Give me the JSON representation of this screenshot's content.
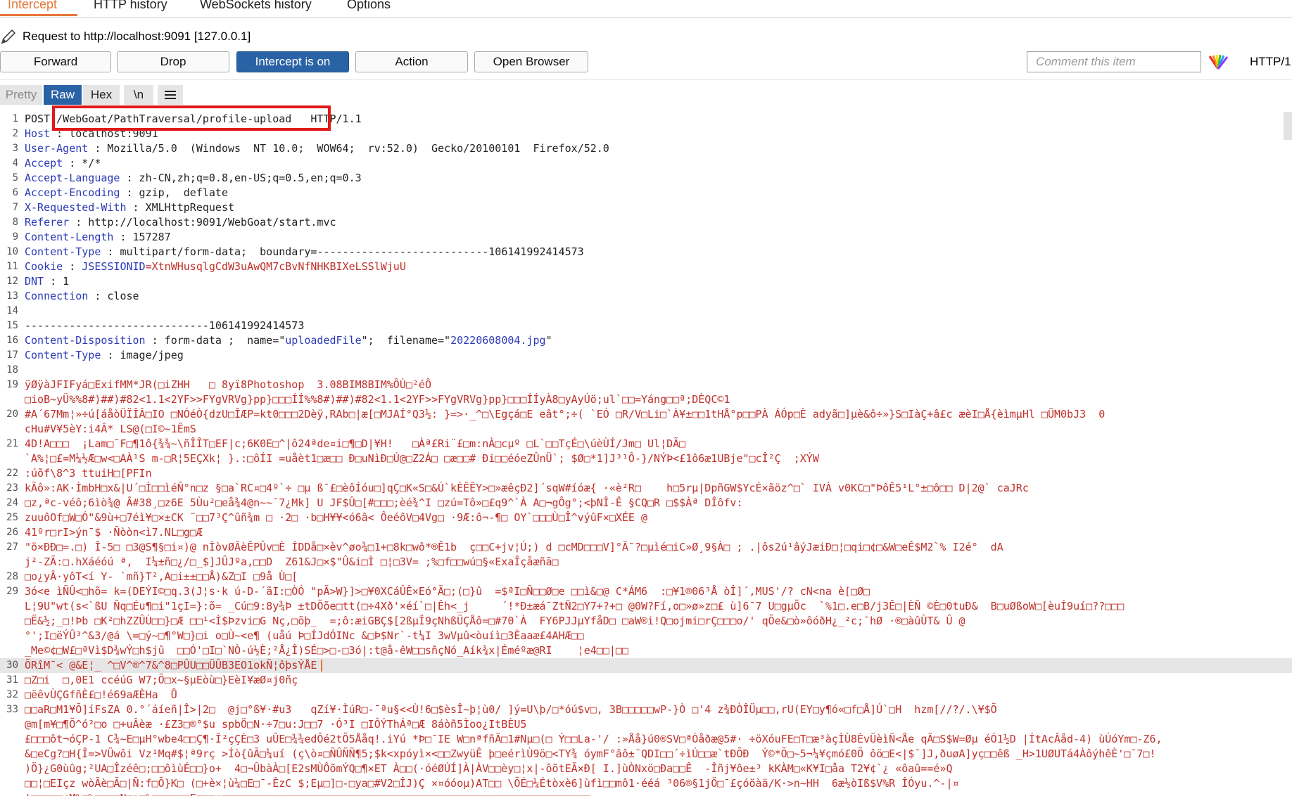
{
  "tabs": [
    "Intercept",
    "HTTP history",
    "WebSockets history",
    "Options"
  ],
  "request_line": "Request to http://localhost:9091  [127.0.0.1]",
  "buttons": {
    "forward": "Forward",
    "drop": "Drop",
    "intercept": "Intercept is on",
    "action": "Action",
    "open_browser": "Open Browser"
  },
  "comment_placeholder": "Comment this item",
  "http_version": "HTTP/1",
  "view_tabs": [
    "Pretty",
    "Raw",
    "Hex",
    "\\n"
  ],
  "menu_icon": "hamburger-menu-icon",
  "colors": {
    "accent": "#e8743a",
    "primary": "#2a63a5",
    "highlight": "#e01919"
  },
  "lines": [
    {
      "n": "1",
      "segs": [
        {
          "t": "POST ",
          "c": "v"
        },
        {
          "t": "/WebGoat/PathTraversal/profile-upload",
          "c": "v"
        },
        {
          "t": "   HTTP/1.1",
          "c": "v"
        }
      ]
    },
    {
      "n": "2",
      "segs": [
        {
          "t": "Host",
          "c": "k"
        },
        {
          "t": " : localhost:9091",
          "c": "v"
        }
      ]
    },
    {
      "n": "3",
      "segs": [
        {
          "t": "User-Agent",
          "c": "k"
        },
        {
          "t": " : Mozilla/5.0  (Windows  NT 10.0;  WOW64;  rv:52.0)  Gecko/20100101  Firefox/52.0",
          "c": "v"
        }
      ]
    },
    {
      "n": "4",
      "segs": [
        {
          "t": "Accept",
          "c": "k"
        },
        {
          "t": " : */*",
          "c": "v"
        }
      ]
    },
    {
      "n": "5",
      "segs": [
        {
          "t": "Accept-Language",
          "c": "k"
        },
        {
          "t": " : zh-CN,zh;q=0.8,en-US;q=0.5,en;q=0.3",
          "c": "v"
        }
      ]
    },
    {
      "n": "6",
      "segs": [
        {
          "t": "Accept-Encoding",
          "c": "k"
        },
        {
          "t": " : gzip,  deflate",
          "c": "v"
        }
      ]
    },
    {
      "n": "7",
      "segs": [
        {
          "t": "X-Requested-With",
          "c": "k"
        },
        {
          "t": " : XMLHttpRequest",
          "c": "v"
        }
      ]
    },
    {
      "n": "8",
      "segs": [
        {
          "t": "Referer",
          "c": "k"
        },
        {
          "t": " : http://localhost:9091/WebGoat/start.mvc",
          "c": "v"
        }
      ]
    },
    {
      "n": "9",
      "segs": [
        {
          "t": "Content-Length",
          "c": "k"
        },
        {
          "t": " : 157287",
          "c": "v"
        }
      ]
    },
    {
      "n": "10",
      "segs": [
        {
          "t": "Content-Type",
          "c": "k"
        },
        {
          "t": " : multipart/form-data;  boundary=---------------------------106141992414573",
          "c": "v"
        }
      ]
    },
    {
      "n": "11",
      "segs": [
        {
          "t": "Cookie",
          "c": "k"
        },
        {
          "t": " : ",
          "c": "v"
        },
        {
          "t": "JSESSIONID",
          "c": "k"
        },
        {
          "t": "=XtnWHusqlgCdW3uAwQM7cBvNfNHKBIXeLSSlWjuU",
          "c": "bin"
        }
      ]
    },
    {
      "n": "12",
      "segs": [
        {
          "t": "DNT",
          "c": "k"
        },
        {
          "t": " : 1",
          "c": "v"
        }
      ]
    },
    {
      "n": "13",
      "segs": [
        {
          "t": "Connection",
          "c": "k"
        },
        {
          "t": " : close",
          "c": "v"
        }
      ]
    },
    {
      "n": "14",
      "segs": []
    },
    {
      "n": "15",
      "segs": [
        {
          "t": "-----------------------------106141992414573",
          "c": "v"
        }
      ]
    },
    {
      "n": "16",
      "segs": [
        {
          "t": "Content-Disposition",
          "c": "k"
        },
        {
          "t": " : form-data ;  name=\"",
          "c": "v"
        },
        {
          "t": "uploadedFile",
          "c": "str"
        },
        {
          "t": "\";  filename=\"",
          "c": "v"
        },
        {
          "t": "20220608004.jpg",
          "c": "str"
        },
        {
          "t": "\"",
          "c": "v"
        }
      ]
    },
    {
      "n": "17",
      "segs": [
        {
          "t": "Content-Type",
          "c": "k"
        },
        {
          "t": " : image/jpeg",
          "c": "v"
        }
      ]
    },
    {
      "n": "18",
      "segs": []
    },
    {
      "n": "19",
      "segs": [
        {
          "t": "ÿØÿàJFIFyá□ExifMM*JR(□iZHH   □ 8yï8Photoshop  3.08BIM8BIM%ÔÙ□²éÔ",
          "c": "bin"
        }
      ]
    },
    {
      "n": "",
      "segs": [
        {
          "t": "□ioB~yÜ%%8#)##)#82<1.1<2YF>>FYgVRVg}pp}□□□ÍÍ%%8#)##)#82<1.1<2YF>>FYgVRVg}pp}□□□ÍÍyÀ8□yAyÚö;ul`□□=Yáng□□ª;DÈQC©1",
          "c": "bin"
        }
      ]
    },
    {
      "n": "20",
      "segs": [
        {
          "t": "#A´67Mm¦»÷ú[áåòÜÏÎÂ□IO □NÓéÒ{dzU□ÎÆP=kt0□□□2Dèÿ,RAb□|æ[□MJAÍ°Q3½: }=>·_^□\\Egçá□E eât°;÷( `EÓ □R/V□Li□`À¥±□□1tHÅ°p□□PÀ ÁÓp□È adyã□]µè&ô÷»}S□IàÇ+â£c æèI□Å{èìmµHl □ÜM0bJ3  0",
          "c": "bin"
        }
      ]
    },
    {
      "n": "",
      "segs": [
        {
          "t": "cHu#V¥5èY:i4Â* LS@(□I©~1ÊmS",
          "c": "bin"
        }
      ]
    },
    {
      "n": "21",
      "segs": [
        {
          "t": "4D!A□□□  ¡Lam□¯F□¶1ô{¾¾~\\ñÎÎT□EF|c;6K0E□^|ô24ªde¤i□¶□D|¥H!   □Àª£Ri¨£□m:nÀ□cµº □L`□□TçÉ□\\úèÙÍ/Jm□ Ul¦DÃ□",
          "c": "bin"
        }
      ]
    },
    {
      "n": "",
      "segs": [
        {
          "t": "`A%¦□£=M¼½Æ□w<□AÀ¹S m-□R¦5EÇXk¦ }.:□ôÍI =uåèt1□æ□□ Ð□uNìÐ□Ú@□Z2Á□ □æ□□# Ði□□éóeZÛnÜ`; $Ø□*1]J³¹Ô-}/NÝÞ<£1ô6æ1UBje\"□cÎ²Ç  ;XÝW",
          "c": "bin"
        }
      ]
    },
    {
      "n": "22",
      "segs": [
        {
          "t": ":úõf\\8^3 ttuiH□[PFIn",
          "c": "bin"
        }
      ]
    },
    {
      "n": "23",
      "segs": [
        {
          "t": "kÃô»:AK·ÌmbH□x&|U´□Ì□□ìéÑ°n□z §□a`RC¤□4º`÷ □µ ß¯£□èôÍóu□]qÇ□K«S□&Ú`kÈÊÊY>□»æêçÐ2]´sqW#íóæ{ ·«è²R□    h□5rµ|DpñGW$YcÉ×ãöz^□` IVÀ v0KC□\"ÞôÊ5¹L°±□ô□□ D|2@` caJRc",
          "c": "bin"
        }
      ]
    },
    {
      "n": "24",
      "segs": [
        {
          "t": "□z,ªc-véô;6ìò¾@ Â#38¸□z6E 5Ùu²□eå¾4@n~~¯7¿Mk] U JF$Û□[#□□□;èé¾^I □zú=Tô»□£q9^`À A□¬gÔg°;<þNÎ-Ê §CQ□R □$$Àª DÎôfv:",
          "c": "bin"
        }
      ]
    },
    {
      "n": "25",
      "segs": [
        {
          "t": "zuuôOf□W□Ó\"&9ù+□7éì¥□×±CK ¨□□7³Ç^ûñ¾m □ ·2□ ·b□H¥¥<ó6â< ÔeéôV□4Vg□ ·9Æ:ô¬-¶□ OY`□□□Ù□Î^výûF×□XÉE @",
          "c": "bin"
        }
      ]
    },
    {
      "n": "26",
      "segs": [
        {
          "t": "41ºr□rI>ýn¯$ ·Ñòòn<ì7.NL□g□Æ",
          "c": "bin"
        }
      ]
    },
    {
      "n": "27",
      "segs": [
        {
          "t": "\"ö×ÐÐ□=.□) Î-5□ □3@S¶§□i¤)@ nÌòvØÂèÊPÛv□È ÍDDå□×èv^øo¾□1+□8k□wô*®Ê1b  ç□□C+jv¦Ú;) d □cMD□□□V]°Ã¯?□µìé□iC»Ø¸9§À□ ; .|ôs2ú¹âýJæiÐ□¦□qi□¢□&W□eÊ$M2`% I2é°  dA",
          "c": "bin"
        }
      ]
    },
    {
      "n": "",
      "segs": [
        {
          "t": "j²-ZÃ:□.hXáéóú ª,  I¼±ñ□¿/□_$]JÛJºa,□□D  Z61&J□×$\"Û&i□Ì □¦□3V= ;%□f□□wú□§«ExaÎçåæñã□",
          "c": "bin"
        }
      ]
    },
    {
      "n": "28",
      "segs": [
        {
          "t": "□o¿yÂ·yôT<í Y- `mñ}T²,A□i±±□□Å)&Z□I □9å Ù□[",
          "c": "bin"
        }
      ]
    },
    {
      "n": "29",
      "segs": [
        {
          "t": "3ó<e ìÑÛ<□hõ= k=(DEÝI©□q.3(J¦s·k ú-D-´ãI:□ÒÓ \"pÃ>W}]>□¥0XCáÛÊ×Eó°Ã□;(□}û  =$ªI□Ñ□□Ø□e □□ì&□@ C*ÁM6  :□¥1®06³Å òÎ]´,MUS'/? cN<na è[□Ø□",
          "c": "bin"
        }
      ]
    },
    {
      "n": "",
      "segs": [
        {
          "t": "L¦9U\"wt(s<`ßU Ñq□Éu¶□i\"1çI=}:õ= _Cú□9:8y¾Þ ±tDÕõe□tt(□÷4Xð'×éí`□|Êh<_j     ´!*Ð±æá¯ZtÑ2□Y7+?+□ @0W?Fí,o□»ø»z□£ ù]6¯7 U□gµÕc  `%1□.e□B/j3Ê□|ÈÑ ©È□0tuÐ&  B□uØßoW□[èuÍ9uí□??□□□",
          "c": "bin"
        }
      ]
    },
    {
      "n": "",
      "segs": [
        {
          "t": "□Ë&½;_□!Þb □K²□hZZÛÙ□□}□Æ □□¹<Ì$Þzvi□G Nç,□õþ_  =;ô:æiGBÇ$[2ßµÎ9çNhßÜÇÅô=□#70`À  FY6PJJµYfåD□ □aW®i!Q□ojmi□rÇ□□□o/' qÕe&□ò»ôóðH¿_²c;¯hØ ·®□àûÙT& Û @",
          "c": "bin"
        }
      ]
    },
    {
      "n": "",
      "segs": [
        {
          "t": "°';I□ëÝÛ³^&3/@á \\=□ý~□¶°W□}□i o□Ù~<e¶ (uåú Þ□ÍJdÓINc &□Þ$Nr`-t¼I 3wVµû<òuíì□3Èaaæ£4AHÆ□□",
          "c": "bin"
        }
      ]
    },
    {
      "n": "",
      "segs": [
        {
          "t": "_Me©¢□W£□ªVì$D¾wÝ□h$jû  □□Ó'□I□`NÒ-ú½È;²Å¿Î)SÉ□>□-□3ó|:t@å-êW□□sñçNó_Aík¾x|Éméºæ@RI    ¦e4□□|□□",
          "c": "bin"
        }
      ]
    },
    {
      "n": "30",
      "hl": true,
      "caret": true,
      "segs": [
        {
          "t": "ÕRîM¯< @&E¦_ ^□V^®^7&^8□PÛU□□ÜÛB3EO1okÑ¦ôþsÝÅE",
          "c": "bin"
        }
      ]
    },
    {
      "n": "31",
      "segs": [
        {
          "t": "□Z□i  □,0E1 ccéúG W7;Õ□x~§µEòù□}EèI¥æØ¤j0ñç",
          "c": "bin"
        }
      ]
    },
    {
      "n": "32",
      "segs": [
        {
          "t": "□ëêvÙÇGfñÈ£□!é69aÆÈHa  Ů",
          "c": "bin"
        }
      ]
    },
    {
      "n": "33",
      "segs": [
        {
          "t": "□□aR□M1¥Õ]íFsZA 0.°´áíeñ|Î>|2□  @j□°ß¥·#u3   qZí¥·ÌúR□-¯ªu§<<Ù!6□$èsÎ~þ¦ù0/ ]ý=U\\þ/□*óú$v□, 3B□□□□□wP-}Ò □'4 z¾ÐÒÎÜµ□□,rU(EY□y¶ó«□f□Å]Ú`□H  hzm[//?/.\\¥$Õ",
          "c": "bin"
        }
      ]
    },
    {
      "n": "",
      "segs": [
        {
          "t": "@m[m¥□¶Õ^ó²□o □+uÂèæ ·£Z3□®°$u spbÖ□N·÷7□u:J□□7 ·Ó³I □IÔÝThÁª□Æ 8áòñ5Ìoo¿ItBÈU5",
          "c": "bin"
        }
      ]
    },
    {
      "n": "",
      "segs": [
        {
          "t": "£□□□ôt¬óÇP-1 C¾~E□µH°wbe4□□Ç¶·Î²çÇÈ□3 uÛE□¾¾edÔé2tÕ5Ååq!.iYú *Þ□¯IE W□nªfñÃ□1#Nµ□(□ Ý□□La-'/ :»Åå}ú0®SV□ªÒåðæ@5#· ÷öXóuFE□T□æ³àçÌÙ8ÈvÜèìÑ<Åe qÃ□S$W=Øµ éÓ1½D |ÍtAcÂåd-4) ùÚóYm□-Z6,",
          "c": "bin"
        }
      ]
    },
    {
      "n": "",
      "segs": [
        {
          "t": "&□eCg?□H{Î=>VÜwôi Vz¹Mq#$¦ª9rç >Íò{ûÃ□¼uí (ç\\ò¤□ÑÛÑÑ¶5;$k<xpóyì×<□□ZwyüÊ þ□eérìÙ9ö□<TY¾ óymF°âô±¯QDI□□´÷ìÚ□□æ`tÐÕÐ  Ý©*Õ□~5¬¼¥çmó£0Õ ôö□E<|$¯]J,ðuøA]yç□□êß _H>1UØUTá4ÀôýhêÈ'□¯7□!",
          "c": "bin"
        }
      ]
    },
    {
      "n": "",
      "segs": [
        {
          "t": ")Ö}¿G0ùûg;²UA□Îzéê□;□□ôìùÉ□□}o+  4□¬ÛbàÀ□[E2sMÙÔõmÝQ□¶×ET À□□(·óéØÚÍ]À|ÀV□□èy□¦x|-ôõtEÃ×Ð[ I.]ùÒNxö□Ða□□Ê  -Îñj¥ôe±³ kKÀM□«K¥I□åa T2¥¢`¿ «ôaû==é»Q",
          "c": "bin"
        }
      ]
    },
    {
      "n": "",
      "segs": [
        {
          "t": "□□¦□EIçz wòÃè□Ã□|Ñ:f□Õ}K□ (□+è×¦ù¼□E□¯-ÊzC $;Eµ□]□-□ya□#V2□ÎJ)Ç ×¤óóoµ)AT□□ \\ÕÉ□¼Étòxè6]ùfì□□mô1·ééá ³06®§1jÖ□¯£çóöàä/K·>n~HH  6æ½òIß$V%R ÎÓyu.^-|¤",
          "c": "bin"
        }
      ]
    },
    {
      "n": "",
      "segs": [
        {
          "t": "'□□□□□cM%□%□□□□N□a□%□□□□□□E□□□q□□□□□□□□□□□□□□□□□□□□□□□□□□□□□□□□□□□□□□□□□□□□□□□□□□□□□□□□□□",
          "c": "bin"
        }
      ]
    }
  ]
}
